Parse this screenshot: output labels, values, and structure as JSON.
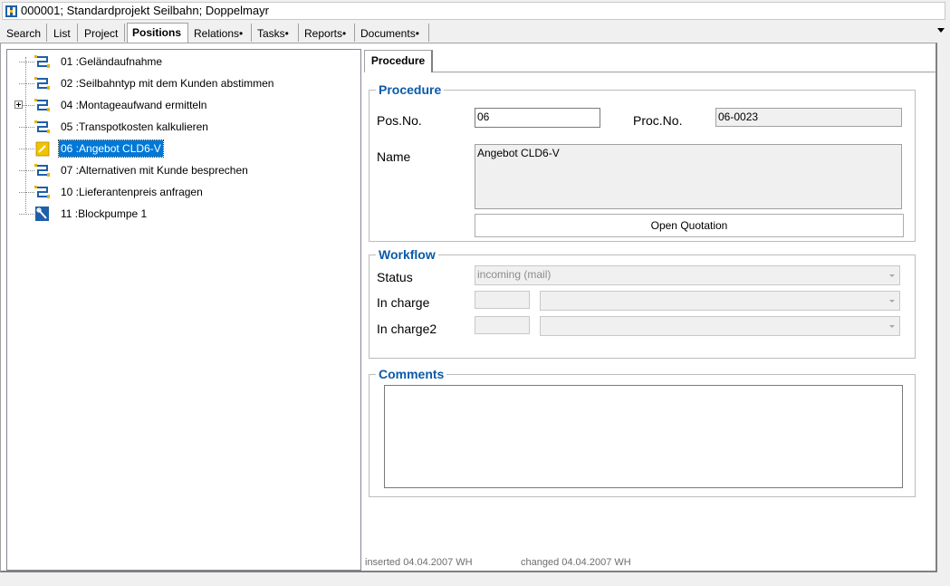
{
  "window": {
    "title": "000001; Standardprojekt Seilbahn; Doppelmayr",
    "icon": "project-icon"
  },
  "tabs": [
    {
      "label": "Search"
    },
    {
      "label": "List"
    },
    {
      "label": "Project"
    },
    {
      "label": "Positions",
      "active": true
    },
    {
      "label": "Relations•"
    },
    {
      "label": "Tasks•"
    },
    {
      "label": "Reports•"
    },
    {
      "label": "Documents•"
    }
  ],
  "tree": {
    "items": [
      {
        "label": "01 :Geländaufnahme",
        "icon": "workflow-icon"
      },
      {
        "label": "02 :Seilbahntyp mit dem Kunden abstimmen",
        "icon": "workflow-icon"
      },
      {
        "label": "04 :Montageaufwand ermitteln",
        "icon": "workflow-icon",
        "expandable": true
      },
      {
        "label": "05 :Transpotkosten kalkulieren",
        "icon": "workflow-icon"
      },
      {
        "label": "06 :Angebot CLD6-V",
        "icon": "pencil-icon",
        "selected": true
      },
      {
        "label": "07 :Alternativen mit Kunde besprechen",
        "icon": "workflow-icon"
      },
      {
        "label": "10 :Lieferantenpreis anfragen",
        "icon": "workflow-icon"
      },
      {
        "label": "11 :Blockpumpe 1",
        "icon": "wrench-icon"
      }
    ]
  },
  "detail_tab": {
    "label": "Procedure"
  },
  "procedure": {
    "title": "Procedure",
    "pos_no_label": "Pos.No.",
    "pos_no_value": "06",
    "proc_no_label": "Proc.No.",
    "proc_no_value": "06-0023",
    "name_label": "Name",
    "name_value": "Angebot CLD6-V",
    "open_button": "Open Quotation"
  },
  "workflow": {
    "title": "Workflow",
    "status_label": "Status",
    "status_value": "incoming (mail)",
    "in_charge_label": "In charge",
    "in_charge_code": "",
    "in_charge_value": "",
    "in_charge2_label": "In charge2",
    "in_charge2_code": "",
    "in_charge2_value": ""
  },
  "comments": {
    "title": "Comments",
    "value": ""
  },
  "footer": {
    "inserted": "inserted   04.04.2007  WH",
    "changed": "changed 04.04.2007  WH"
  }
}
